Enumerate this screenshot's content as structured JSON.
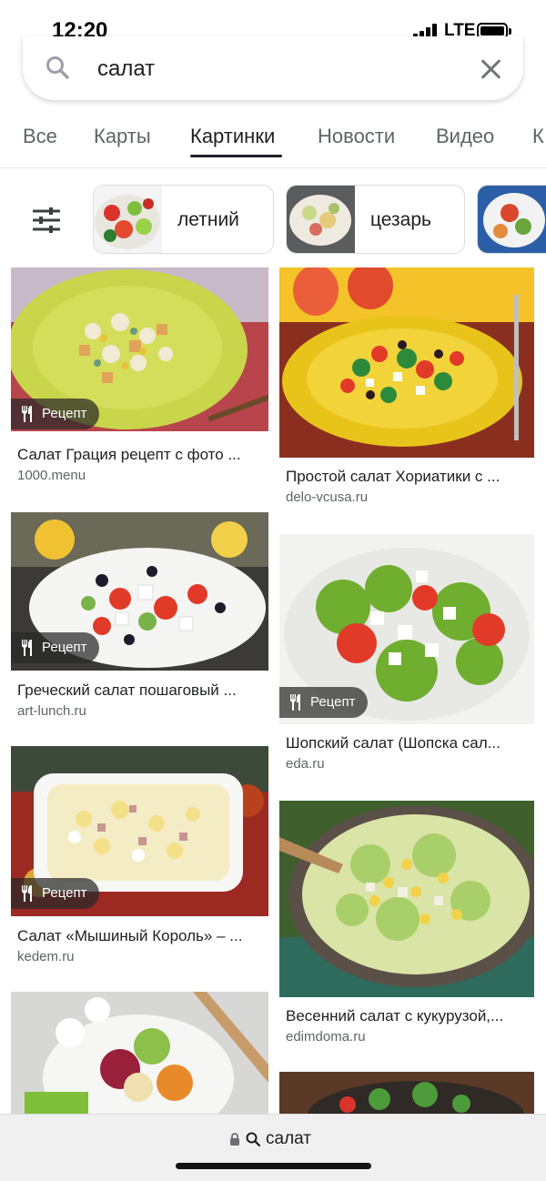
{
  "status_bar": {
    "time": "12:20",
    "network": "LTE"
  },
  "search": {
    "query": "салат"
  },
  "tabs": [
    {
      "label": "Все"
    },
    {
      "label": "Карты"
    },
    {
      "label": "Картинки",
      "active": true
    },
    {
      "label": "Новости"
    },
    {
      "label": "Видео"
    },
    {
      "label": "К"
    }
  ],
  "chips": [
    {
      "label": "летний"
    },
    {
      "label": "цезарь"
    }
  ],
  "results": [
    {
      "title": "Салат Грация рецепт с фото ...",
      "source": "1000.menu",
      "badge": "Рецепт"
    },
    {
      "title": "Простой салат Хориатики с ...",
      "source": "delo-vcusa.ru"
    },
    {
      "title": "Греческий салат пошаговый ...",
      "source": "art-lunch.ru",
      "badge": "Рецепт"
    },
    {
      "title": "Шопский салат (Шопска сал...",
      "source": "eda.ru",
      "badge": "Рецепт"
    },
    {
      "title": "Салат «Мышиный Король» – ...",
      "source": "kedem.ru",
      "badge": "Рецепт"
    },
    {
      "title": "Весенний салат с кукурузой,...",
      "source": "edimdoma.ru"
    }
  ],
  "bottom_bar": {
    "address": "салат"
  },
  "colors": {
    "active_tab": "#202124",
    "inactive_tab": "#5f6368",
    "badge_bg": "#282828"
  }
}
